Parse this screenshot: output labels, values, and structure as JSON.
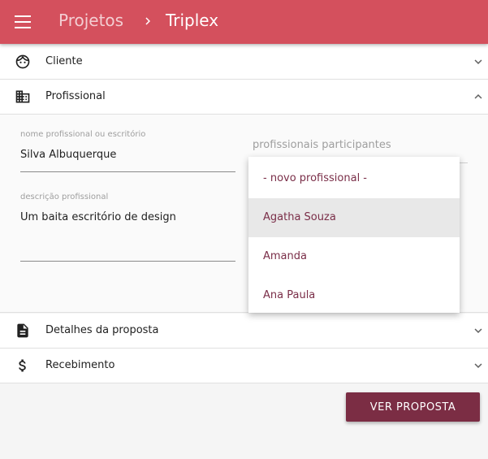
{
  "app_bar": {
    "breadcrumb_root": "Projetos",
    "breadcrumb_current": "Triplex",
    "color": "#d4505d"
  },
  "panels": [
    {
      "title": "Cliente",
      "icon": "face-icon",
      "expanded": false
    },
    {
      "title": "Profissional",
      "icon": "business-icon",
      "expanded": true
    },
    {
      "title": "Detalhes da proposta",
      "icon": "description-icon",
      "expanded": false
    },
    {
      "title": "Recebimento",
      "icon": "dollar-icon",
      "expanded": false
    }
  ],
  "profissional": {
    "name_label": "nome profissional ou escritório",
    "name_value": "Silva Albuquerque",
    "desc_label": "descrição profissional",
    "desc_value": "Um baita escritório de design",
    "participants_label": "profissionais participantes"
  },
  "dropdown": {
    "options": [
      "- novo profissional -",
      "Agatha Souza",
      "Amanda",
      "Ana Paula"
    ],
    "highlighted": "Agatha Souza",
    "text_color": "#7a2e48"
  },
  "actions": {
    "ver_proposta": "VER PROPOSTA",
    "button_color": "#7b2d44"
  }
}
